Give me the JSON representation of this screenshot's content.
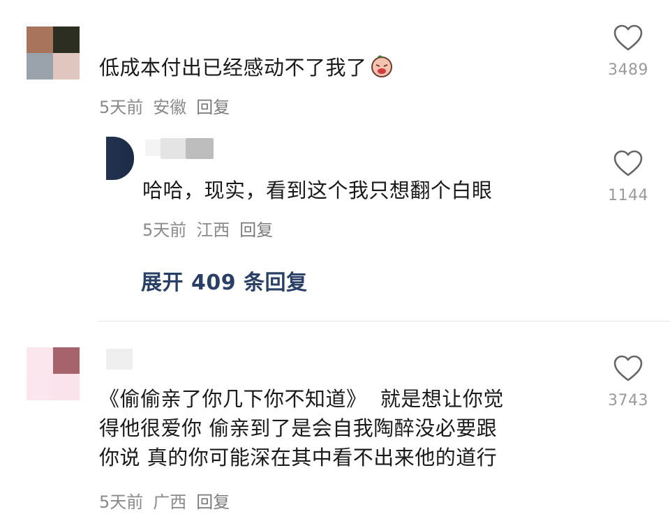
{
  "comments": [
    {
      "text": "低成本付出已经感动不了我了",
      "emoji": "crying-face-emoji",
      "meta": {
        "time": "5天前",
        "location": "安徽",
        "reply": "回复"
      },
      "likes": "3489",
      "avatar_colors": [
        "#a8755c",
        "#2c2e22",
        "#9aa2ab",
        "#e1c5bf"
      ]
    },
    {
      "text": "哈哈，现实，看到这个我只想翻个白眼",
      "meta": {
        "time": "5天前",
        "location": "江西",
        "reply": "回复"
      },
      "likes": "1144"
    },
    {
      "text_lines": [
        "《偷偷亲了你几下你不知道》  就是想让你觉",
        "得他很爱你 偷亲到了是会自我陶醉没必要跟",
        "你说 真的你可能深在其中看不出来他的道行"
      ],
      "meta": {
        "time": "5天前",
        "location": "广西",
        "reply": "回复"
      },
      "likes": "3743",
      "avatar_colors": [
        "#fbe6ee",
        "#a6636c",
        "#fbe5ee",
        "#fbe3ec"
      ]
    }
  ],
  "expand_replies": "展开 409 条回复",
  "icons": {
    "like": "heart-outline-icon"
  }
}
